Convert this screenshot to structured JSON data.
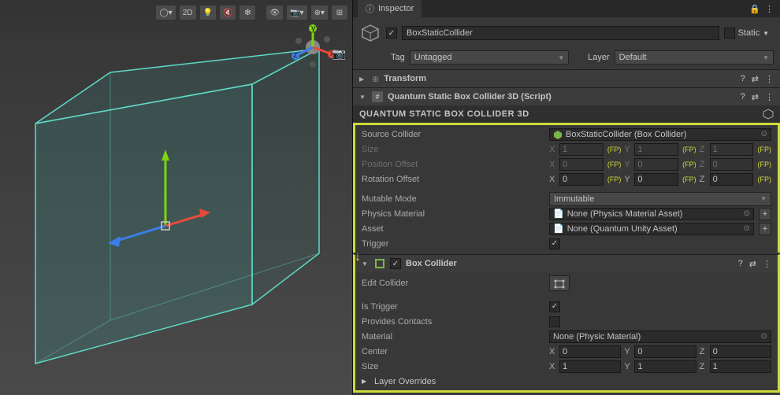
{
  "scene_toolbar": {
    "mode2d": "2D"
  },
  "inspector": {
    "tab": "Inspector",
    "object_name": "BoxStaticCollider",
    "static_label": "Static",
    "tag_label": "Tag",
    "tag_value": "Untagged",
    "layer_label": "Layer",
    "layer_value": "Default"
  },
  "transform": {
    "title": "Transform"
  },
  "qcomp": {
    "title": "Quantum Static Box Collider 3D (Script)",
    "section": "QUANTUM STATIC BOX COLLIDER 3D",
    "source_label": "Source Collider",
    "source_value": "BoxStaticCollider (Box Collider)",
    "size_label": "Size",
    "size": {
      "x": "1",
      "y": "1",
      "z": "1"
    },
    "pos_label": "Position Offset",
    "pos": {
      "x": "0",
      "y": "0",
      "z": "0"
    },
    "rot_label": "Rotation Offset",
    "rot": {
      "x": "0",
      "y": "0",
      "z": "0"
    },
    "mutable_label": "Mutable Mode",
    "mutable_value": "Immutable",
    "pmat_label": "Physics Material",
    "pmat_value": "None (Physics Material Asset)",
    "asset_label": "Asset",
    "asset_value": "None (Quantum Unity Asset)",
    "trigger_label": "Trigger",
    "fp": "(FP)"
  },
  "box": {
    "title": "Box Collider",
    "edit_label": "Edit Collider",
    "istrigger": "Is Trigger",
    "provides": "Provides Contacts",
    "material_label": "Material",
    "material_value": "None (Physic Material)",
    "center_label": "Center",
    "center": {
      "x": "0",
      "y": "0",
      "z": "0"
    },
    "size_label": "Size",
    "size": {
      "x": "1",
      "y": "1",
      "z": "1"
    },
    "overrides": "Layer Overrides"
  },
  "axes": {
    "x": "X",
    "y": "Y",
    "z": "Z"
  }
}
